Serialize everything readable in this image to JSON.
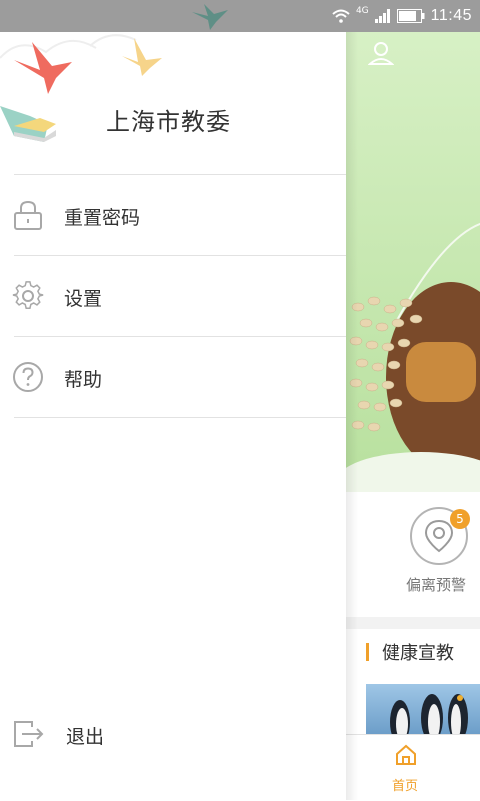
{
  "status_bar": {
    "network": "4G",
    "time": "11:45"
  },
  "drawer": {
    "org_name": "上海市教委",
    "menu_items": [
      {
        "label": "重置密码",
        "icon": "lock-icon"
      },
      {
        "label": "设置",
        "icon": "gear-icon"
      },
      {
        "label": "帮助",
        "icon": "help-icon"
      }
    ],
    "logout_label": "退出",
    "logout_icon": "logout-icon"
  },
  "background_app": {
    "alert_label": "偏离预警",
    "alert_badge_count": "5",
    "health_section_title": "健康宣教",
    "tabbar": {
      "home_label": "首页"
    }
  },
  "colors": {
    "accent": "#f0a02a",
    "status_bar": "#9c9c9c",
    "banner_green": "#b8e09e"
  }
}
